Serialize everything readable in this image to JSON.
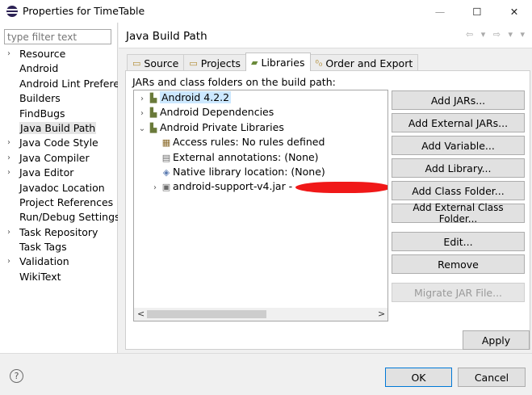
{
  "window": {
    "title": "Properties for TimeTable",
    "minimize": "—",
    "maximize": "☐",
    "close": "✕"
  },
  "left": {
    "filter_placeholder": "type filter text",
    "items": [
      {
        "label": "Resource",
        "expandable": true
      },
      {
        "label": "Android",
        "expandable": false
      },
      {
        "label": "Android Lint Preferences",
        "expandable": false
      },
      {
        "label": "Builders",
        "expandable": false
      },
      {
        "label": "FindBugs",
        "expandable": false
      },
      {
        "label": "Java Build Path",
        "expandable": false,
        "selected": true
      },
      {
        "label": "Java Code Style",
        "expandable": true
      },
      {
        "label": "Java Compiler",
        "expandable": true
      },
      {
        "label": "Java Editor",
        "expandable": true
      },
      {
        "label": "Javadoc Location",
        "expandable": false
      },
      {
        "label": "Project References",
        "expandable": false
      },
      {
        "label": "Run/Debug Settings",
        "expandable": false
      },
      {
        "label": "Task Repository",
        "expandable": true
      },
      {
        "label": "Task Tags",
        "expandable": false
      },
      {
        "label": "Validation",
        "expandable": true
      },
      {
        "label": "WikiText",
        "expandable": false
      }
    ],
    "scroll_left": "<",
    "scroll_right": ">"
  },
  "page": {
    "title": "Java Build Path",
    "nav_arrows": "⇦ ▾ ⇨ ▾ ▾"
  },
  "tabs": [
    {
      "label": "Source",
      "icon": "source-folder-icon",
      "active": false
    },
    {
      "label": "Projects",
      "icon": "projects-icon",
      "active": false
    },
    {
      "label": "Libraries",
      "icon": "libraries-icon",
      "active": true
    },
    {
      "label": "Order and Export",
      "icon": "order-export-icon",
      "active": false
    }
  ],
  "libraries": {
    "heading": "JARs and class folders on the build path:",
    "tree": [
      {
        "label": "Android 4.2.2",
        "toggle": ">",
        "icon": "library-icon",
        "level": 0,
        "selected": true
      },
      {
        "label": "Android Dependencies",
        "toggle": ">",
        "icon": "library-icon",
        "level": 0
      },
      {
        "label": "Android Private Libraries",
        "toggle": "v",
        "icon": "library-icon",
        "level": 0
      },
      {
        "label": "Access rules: No rules defined",
        "toggle": "",
        "icon": "access-rules-icon",
        "level": 1
      },
      {
        "label": "External annotations: (None)",
        "toggle": "",
        "icon": "annotations-icon",
        "level": 1
      },
      {
        "label": "Native library location: (None)",
        "toggle": "",
        "icon": "native-library-icon",
        "level": 1
      },
      {
        "label": "android-support-v4.jar -",
        "toggle": ">",
        "icon": "jar-icon",
        "level": 1,
        "redacted": true
      }
    ],
    "scroll_left": "<",
    "scroll_right": ">"
  },
  "buttons": {
    "add_jars": "Add JARs...",
    "add_external_jars": "Add External JARs...",
    "add_variable": "Add Variable...",
    "add_library": "Add Library...",
    "add_class_folder": "Add Class Folder...",
    "add_external_class_folder": "Add External Class Folder...",
    "edit": "Edit...",
    "remove": "Remove",
    "migrate_jar": "Migrate JAR File...",
    "apply": "Apply",
    "ok": "OK",
    "cancel": "Cancel"
  },
  "help": "?"
}
